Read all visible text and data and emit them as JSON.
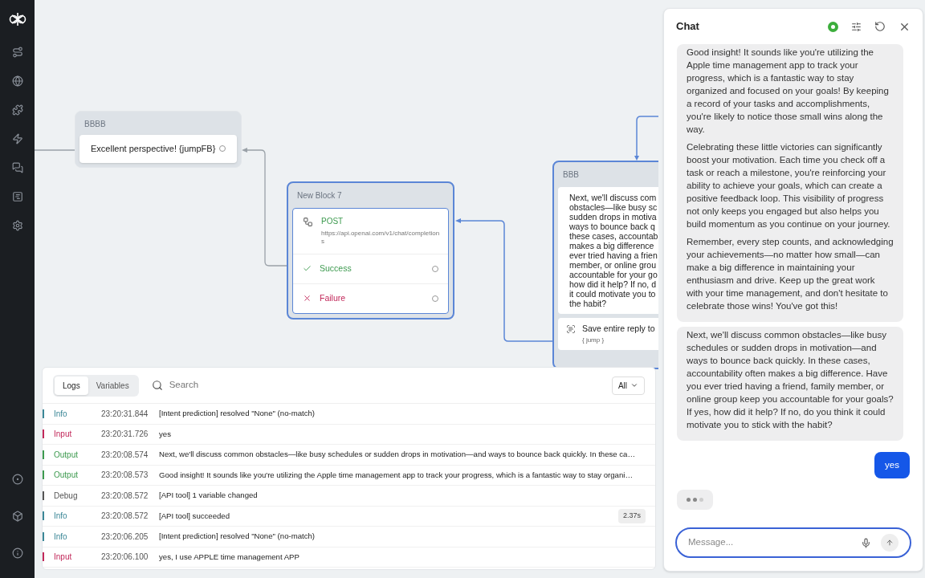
{
  "canvas": {
    "blocks": [
      {
        "kind": "text",
        "title": "BBBB",
        "selected": false,
        "steps": [
          {
            "text": "Excellent perspective! {jumpFB}"
          }
        ]
      },
      {
        "kind": "api",
        "title": "New Block 7",
        "selected": true,
        "method": "POST",
        "url": "https://api.openai.com/v1/chat/completions",
        "outcomes": [
          {
            "kind": "success",
            "label": "Success"
          },
          {
            "kind": "failure",
            "label": "Failure"
          }
        ]
      },
      {
        "kind": "message",
        "title": "BBB",
        "selected": true,
        "lines": [
          "Next, we'll discuss com",
          "obstacles—like busy sc",
          "sudden drops in motiva",
          "ways to bounce back q",
          "these cases, accountab",
          "makes a big difference",
          "ever tried having a frien",
          "member, or online grou",
          "accountable for your go",
          "how did it help? If no, d",
          "it could motivate you to",
          "the habit?"
        ],
        "capture": {
          "label": "Save entire reply to",
          "variable": "{ jump }"
        }
      }
    ]
  },
  "logs": {
    "tabs": [
      {
        "label": "Logs",
        "selected": true
      },
      {
        "label": "Variables",
        "selected": false
      }
    ],
    "search": {
      "placeholder": "Search"
    },
    "filter": "All",
    "entries": [
      {
        "kind": "info",
        "level": "Info",
        "time": "23:20:31.844",
        "message": "[Intent prediction] resolved \"None\" (no-match)"
      },
      {
        "kind": "input",
        "level": "Input",
        "time": "23:20:31.726",
        "message": "yes"
      },
      {
        "kind": "output",
        "level": "Output",
        "time": "23:20:08.574",
        "message": "Next, we'll discuss common obstacles—like busy schedules or sudden drops in motivation—and ways to bounce back quickly. In these ca…"
      },
      {
        "kind": "output",
        "level": "Output",
        "time": "23:20:08.573",
        "message": "Good insight! It sounds like you're utilizing the Apple time management app to track your progress, which is a fantastic way to stay organi…"
      },
      {
        "kind": "debug",
        "level": "Debug",
        "time": "23:20:08.572",
        "message": "[API tool] 1 variable changed"
      },
      {
        "kind": "info",
        "level": "Info",
        "time": "23:20:08.572",
        "message": "[API tool] succeeded",
        "duration": "2.37s"
      },
      {
        "kind": "info",
        "level": "Info",
        "time": "23:20:06.205",
        "message": "[Intent prediction] resolved \"None\" (no-match)"
      },
      {
        "kind": "input",
        "level": "Input",
        "time": "23:20:06.100",
        "message": "yes, I use APPLE time management APP"
      }
    ]
  },
  "chat": {
    "title": "Chat",
    "messages": [
      {
        "kind": "bot",
        "paragraphs": [
          "Good insight! It sounds like you're utilizing the Apple time management app to track your progress, which is a fantastic way to stay organized and focused on your goals! By keeping a record of your tasks and accomplishments, you're likely to notice those small wins along the way.",
          "Celebrating these little victories can significantly boost your motivation. Each time you check off a task or reach a milestone, you're reinforcing your ability to achieve your goals, which can create a positive feedback loop. This visibility of progress not only keeps you engaged but also helps you build momentum as you continue on your journey.",
          "Remember, every step counts, and acknowledging your achievements—no matter how small—can make a big difference in maintaining your enthusiasm and drive. Keep up the great work with your time management, and don't hesitate to celebrate those wins! You've got this!"
        ]
      },
      {
        "kind": "bot",
        "paragraphs": [
          "Next, we'll discuss common obstacles—like busy schedules or sudden drops in motivation—and ways to bounce back quickly. In these cases, accountability often makes a big difference. Have you ever tried having a friend, family member, or online group keep you accountable for your goals? If yes, how did it help? If no, do you think it could motivate you to stick with the habit?"
        ]
      },
      {
        "kind": "user",
        "paragraphs": [
          "yes"
        ]
      }
    ],
    "typing": true,
    "input": {
      "placeholder": "Message..."
    }
  }
}
